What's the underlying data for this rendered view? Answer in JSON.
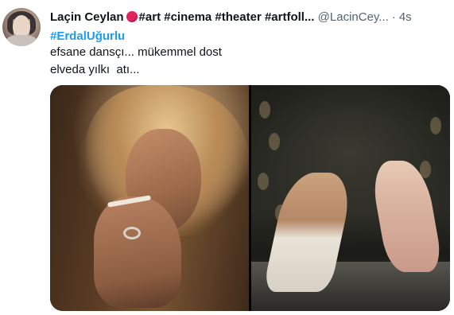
{
  "tweet": {
    "author_name": "Laçin Ceylan",
    "tags": "#art #cinema #theater #artfoll...",
    "handle": "@LacinCey...",
    "separator": "·",
    "time": "4s",
    "hashtag": "#ErdalUğurlu",
    "text_line1": "efsane dansçı... mükemmel dost",
    "text_line2": "elveda yılkı  atı..."
  },
  "colors": {
    "accent": "#1d9bf0",
    "text": "#0f1419",
    "secondary": "#536471",
    "record_dot": "#e0245e"
  },
  "icons": {
    "status": "red-circle-icon"
  }
}
